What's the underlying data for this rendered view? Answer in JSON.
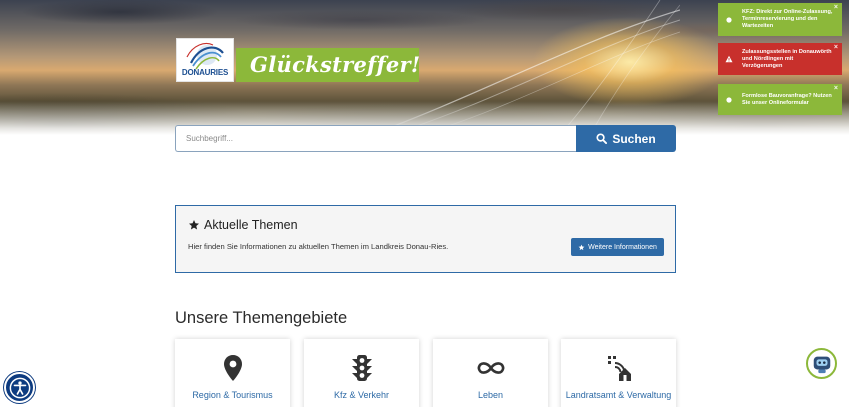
{
  "brand": {
    "logo_text": "DONAURIES",
    "slogan": "Glückstreffer!"
  },
  "notifications": [
    {
      "text": "KFZ: Direkt zur Online-Zulassung, Terminreservierung und den Wartezeiten",
      "color": "#8cb83a",
      "icon": "circle-icon"
    },
    {
      "text": "Zulassungsstellen in Donauwörth und Nördlingen mit Verzögerungen",
      "color": "#c8302c",
      "icon": "warning-icon"
    },
    {
      "text": "Formlose Bauvoranfrage? Nutzen Sie unser Onlineformular",
      "color": "#8cb83a",
      "icon": "circle-icon"
    }
  ],
  "search": {
    "placeholder": "Suchbegriff...",
    "button_label": "Suchen"
  },
  "aktuelle_themen": {
    "title": "Aktuelle Themen",
    "text": "Hier finden Sie Informationen zu aktuellen Themen im Landkreis Donau-Ries.",
    "button_label": "Weitere Informationen"
  },
  "themengebiete": {
    "heading": "Unsere Themengebiete",
    "tiles": [
      {
        "label": "Region & Tourismus",
        "icon": "map-pin-icon"
      },
      {
        "label": "Kfz & Verkehr",
        "icon": "traffic-light-icon"
      },
      {
        "label": "Leben",
        "icon": "infinity-icon"
      },
      {
        "label": "Landratsamt & Verwaltung",
        "icon": "building-signal-icon"
      }
    ]
  },
  "colors": {
    "primary_blue": "#2e6aa6",
    "brand_green": "#8cb83a",
    "alert_red": "#c8302c",
    "a11y_navy": "#0d3b80"
  }
}
